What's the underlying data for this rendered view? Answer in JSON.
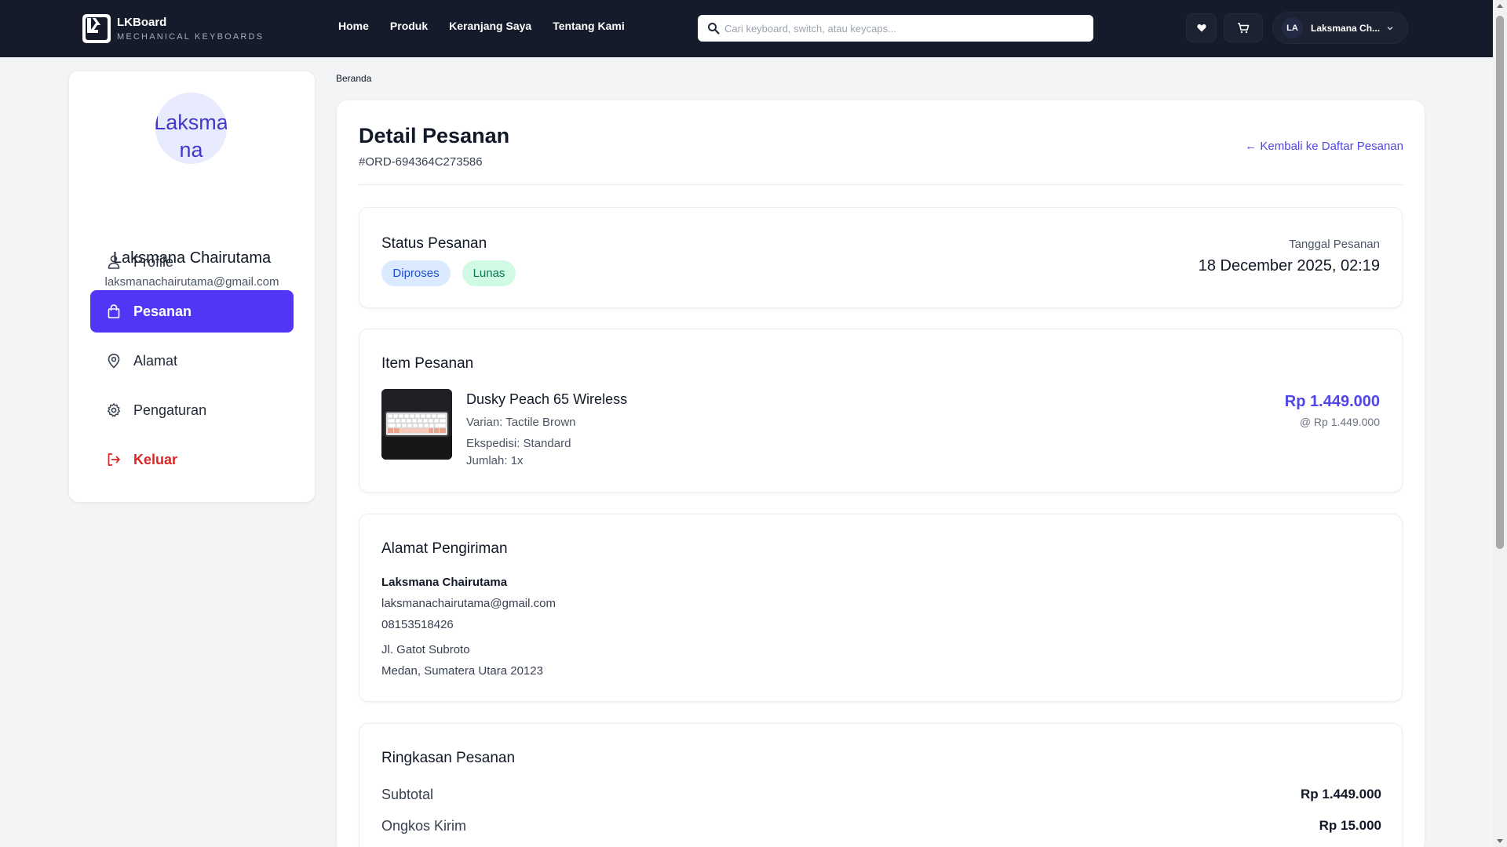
{
  "brand": {
    "name": "LKBoard",
    "tagline": "MECHANICAL KEYBOARDS"
  },
  "nav": {
    "links": [
      "Home",
      "Produk",
      "Keranjang Saya",
      "Tentang Kami"
    ]
  },
  "search": {
    "placeholder": "Cari keyboard, switch, atau keycaps..."
  },
  "user": {
    "initials": "LA",
    "short_name": "Laksmana Ch..."
  },
  "sidebar": {
    "avatar_alt": "Laksmana Chairutama",
    "name": "Laksmana Chairutama",
    "email": "laksmanachairutama@gmail.com",
    "items": [
      {
        "label": "Profile",
        "icon": "user-icon"
      },
      {
        "label": "Pesanan",
        "icon": "bag-icon",
        "active": true
      },
      {
        "label": "Alamat",
        "icon": "map-pin-icon"
      },
      {
        "label": "Pengaturan",
        "icon": "gear-icon"
      },
      {
        "label": "Keluar",
        "icon": "logout-icon"
      }
    ]
  },
  "breadcrumb": "Beranda",
  "order": {
    "title": "Detail Pesanan",
    "id": "#ORD-694364C273586",
    "back_label": "← Kembali ke Daftar Pesanan"
  },
  "status": {
    "title": "Status Pesanan",
    "badges": [
      "Diproses",
      "Lunas"
    ],
    "date_label": "Tanggal Pesanan",
    "date_value": "18 December 2025, 02:19"
  },
  "items": {
    "title": "Item Pesanan",
    "list": [
      {
        "name": "Dusky Peach 65 Wireless",
        "variant": "Varian: Tactile Brown",
        "shipping": "Ekspedisi: Standard",
        "qty": "Jumlah: 1x",
        "price": "Rp 1.449.000",
        "unit_price": "@ Rp 1.449.000"
      }
    ]
  },
  "address": {
    "title": "Alamat Pengiriman",
    "name": "Laksmana Chairutama",
    "email": "laksmanachairutama@gmail.com",
    "phone": "08153518426",
    "street": "Jl. Gatot Subroto",
    "city": "Medan, Sumatera Utara 20123"
  },
  "summary": {
    "title": "Ringkasan Pesanan",
    "rows": [
      {
        "label": "Subtotal",
        "value": "Rp 1.449.000"
      },
      {
        "label": "Ongkos Kirim",
        "value": "Rp 15.000"
      }
    ]
  },
  "colors": {
    "navbar": "#161b2b",
    "accent": "#5136f5",
    "link": "#4f46e5",
    "danger": "#dc2626"
  }
}
